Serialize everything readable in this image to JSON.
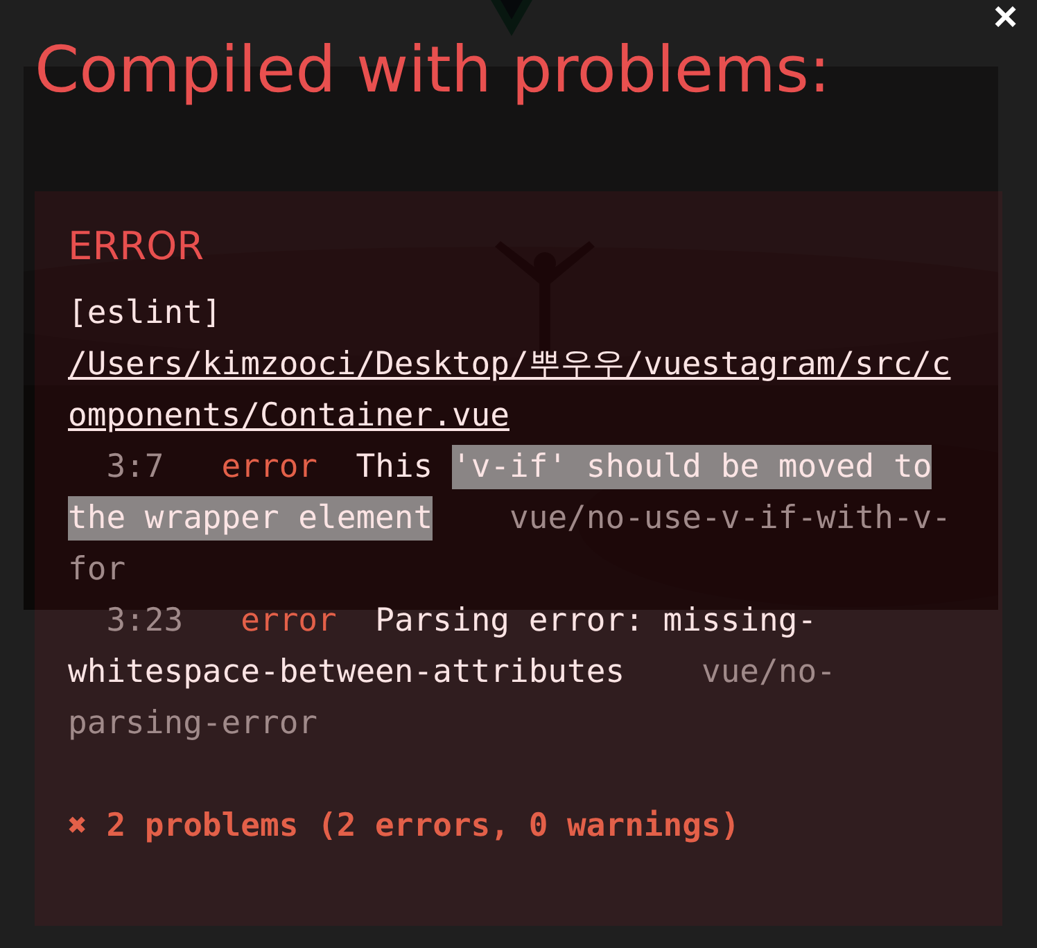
{
  "overlay": {
    "title": "Compiled with problems:",
    "close": "×",
    "error": {
      "heading": "ERROR",
      "source": "[eslint]",
      "file_path": "/Users/kimzooci/Desktop/뿌우우/vuestagram/src/components/Container.vue",
      "problems": [
        {
          "location": "3:7",
          "severity": "error",
          "message": "This ",
          "selected_text": "'v-if' should be moved to the wrapper element",
          "rule": "vue/no-use-v-if-with-v-for"
        },
        {
          "location": "3:23",
          "severity": "error",
          "message": "Parsing error: missing-whitespace-between-attributes",
          "rule": "vue/no-parsing-error"
        }
      ],
      "summary": "✖ 2 problems (2 errors, 0 warnings)"
    }
  }
}
